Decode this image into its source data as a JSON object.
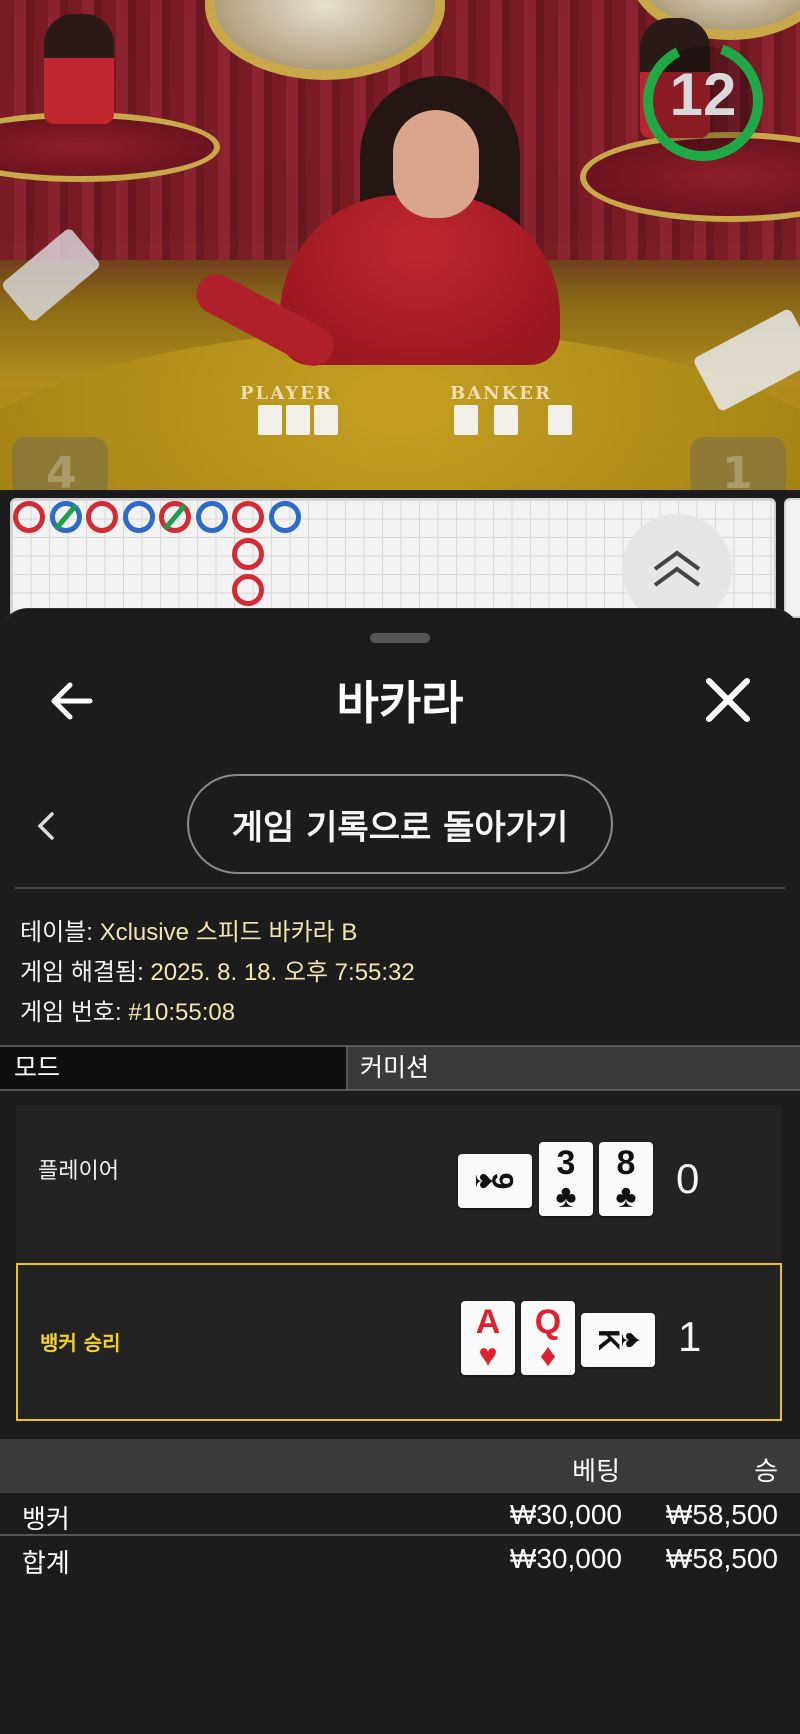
{
  "video": {
    "timer": "12",
    "table_labels": {
      "player": "PLAYER",
      "banker": "BANKER"
    },
    "corner_left": "4",
    "corner_right": "1"
  },
  "roadmap": {
    "beads": [
      {
        "color": "red",
        "col": 0,
        "row": 0,
        "tie": false
      },
      {
        "color": "blue",
        "col": 1,
        "row": 0,
        "tie": true
      },
      {
        "color": "red",
        "col": 2,
        "row": 0,
        "tie": false
      },
      {
        "color": "blue",
        "col": 3,
        "row": 0,
        "tie": false
      },
      {
        "color": "red",
        "col": 4,
        "row": 0,
        "tie": true
      },
      {
        "color": "blue",
        "col": 5,
        "row": 0,
        "tie": false
      },
      {
        "color": "red",
        "col": 6,
        "row": 0,
        "tie": false
      },
      {
        "color": "blue",
        "col": 7,
        "row": 0,
        "tie": false
      },
      {
        "color": "red",
        "col": 6,
        "row": 1,
        "tie": false
      },
      {
        "color": "red",
        "col": 6,
        "row": 2,
        "tie": false
      }
    ]
  },
  "sheet": {
    "title": "바카라",
    "back_icon": "arrow-left-icon",
    "close_icon": "close-icon",
    "history_button": "게임 기록으로 돌아가기"
  },
  "info": {
    "table_label": "테이블: ",
    "table_value": "Xclusive 스피드 바카라 B",
    "resolved_label": "게임 해결됨: ",
    "resolved_value": "2025. 8. 18. 오후 7:55:32",
    "number_label": "게임 번호: ",
    "number_value": "#10:55:08"
  },
  "mode": {
    "label": "모드",
    "value": "커미션"
  },
  "hands": {
    "player": {
      "label": "플레이어",
      "score": "0",
      "cards": [
        {
          "rank": "9",
          "suit": "♠",
          "color": "black",
          "orientation": "side"
        },
        {
          "rank": "3",
          "suit": "♣",
          "color": "black",
          "orientation": "up"
        },
        {
          "rank": "8",
          "suit": "♣",
          "color": "black",
          "orientation": "up"
        }
      ]
    },
    "banker": {
      "label": "뱅커 승리",
      "score": "1",
      "cards": [
        {
          "rank": "A",
          "suit": "♥",
          "color": "red",
          "orientation": "up"
        },
        {
          "rank": "Q",
          "suit": "♦",
          "color": "red",
          "orientation": "up"
        },
        {
          "rank": "K",
          "suit": "♠",
          "color": "black",
          "orientation": "side"
        }
      ]
    }
  },
  "bets": {
    "col_bet": "베팅",
    "col_win": "승",
    "rows": [
      {
        "name": "뱅커",
        "bet": "₩30,000",
        "win": "₩58,500"
      },
      {
        "name": "합계",
        "bet": "₩30,000",
        "win": "₩58,500"
      }
    ]
  },
  "colors": {
    "accent_win": "#e8c520",
    "timer_ring": "#1fa845",
    "bead_red": "#d32b35",
    "bead_blue": "#2c6bc9",
    "tie_line": "#1f9c4a"
  }
}
